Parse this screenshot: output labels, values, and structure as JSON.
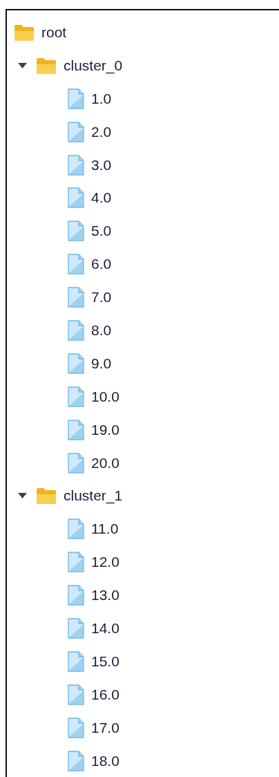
{
  "tree": [
    {
      "label": "root",
      "kind": "folder",
      "children": [
        {
          "label": "cluster_0",
          "kind": "folder",
          "expanded": true,
          "children": [
            {
              "label": "1.0",
              "kind": "file"
            },
            {
              "label": "2.0",
              "kind": "file"
            },
            {
              "label": "3.0",
              "kind": "file"
            },
            {
              "label": "4.0",
              "kind": "file"
            },
            {
              "label": "5.0",
              "kind": "file"
            },
            {
              "label": "6.0",
              "kind": "file"
            },
            {
              "label": "7.0",
              "kind": "file"
            },
            {
              "label": "8.0",
              "kind": "file"
            },
            {
              "label": "9.0",
              "kind": "file"
            },
            {
              "label": "10.0",
              "kind": "file"
            },
            {
              "label": "19.0",
              "kind": "file"
            },
            {
              "label": "20.0",
              "kind": "file"
            }
          ]
        },
        {
          "label": "cluster_1",
          "kind": "folder",
          "expanded": true,
          "children": [
            {
              "label": "11.0",
              "kind": "file"
            },
            {
              "label": "12.0",
              "kind": "file"
            },
            {
              "label": "13.0",
              "kind": "file"
            },
            {
              "label": "14.0",
              "kind": "file"
            },
            {
              "label": "15.0",
              "kind": "file"
            },
            {
              "label": "16.0",
              "kind": "file"
            },
            {
              "label": "17.0",
              "kind": "file"
            },
            {
              "label": "18.0",
              "kind": "file"
            }
          ]
        }
      ]
    }
  ]
}
